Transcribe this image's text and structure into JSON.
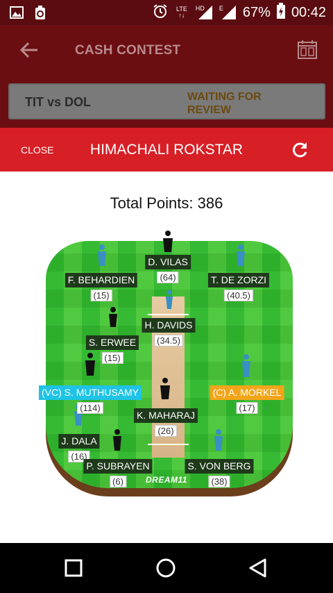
{
  "status_bar": {
    "network_label": "LTE",
    "hd_label": "HD",
    "e_label": "E",
    "battery": "67%",
    "time": "00:42",
    "icons": [
      "gallery-icon",
      "recycle-icon",
      "alarm-icon",
      "signal-icon",
      "battery-charging-icon"
    ]
  },
  "app_bar": {
    "title": "CASH CONTEST",
    "match": "TIT vs DOL",
    "match_status": "WAITING FOR REVIEW"
  },
  "dialog": {
    "close_label": "CLOSE",
    "team_name": "HIMACHALI ROKSTAR",
    "total_points": "Total Points: 386"
  },
  "field": {
    "brand": "DREAM11",
    "players": [
      {
        "name": "D. VILAS",
        "points": "(64)",
        "role": "normal"
      },
      {
        "name": "F. BEHARDIEN",
        "points": "(15)",
        "role": "normal"
      },
      {
        "name": "T. DE ZORZI",
        "points": "(40.5)",
        "role": "normal"
      },
      {
        "name": "H. DAVIDS",
        "points": "(34.5)",
        "role": "normal"
      },
      {
        "name": "S. ERWEE",
        "points": "(15)",
        "role": "normal"
      },
      {
        "name": "(VC) S. MUTHUSAMY",
        "points": "(114)",
        "role": "vc"
      },
      {
        "name": "(C) A. MORKEL",
        "points": "(17)",
        "role": "c"
      },
      {
        "name": "K. MAHARAJ",
        "points": "(26)",
        "role": "normal"
      },
      {
        "name": "J. DALA",
        "points": "(16)",
        "role": "normal"
      },
      {
        "name": "P. SUBRAYEN",
        "points": "(6)",
        "role": "normal"
      },
      {
        "name": "S. VON BERG",
        "points": "(38)",
        "role": "normal"
      }
    ]
  },
  "colors": {
    "status_bar": "#5a0c10",
    "app_bar_dimmed": "#6a0e12",
    "dialog_header": "#d71f26",
    "vice_captain": "#1ec3e6",
    "captain": "#f2a51a",
    "name_tag": "#1f3a1b"
  }
}
